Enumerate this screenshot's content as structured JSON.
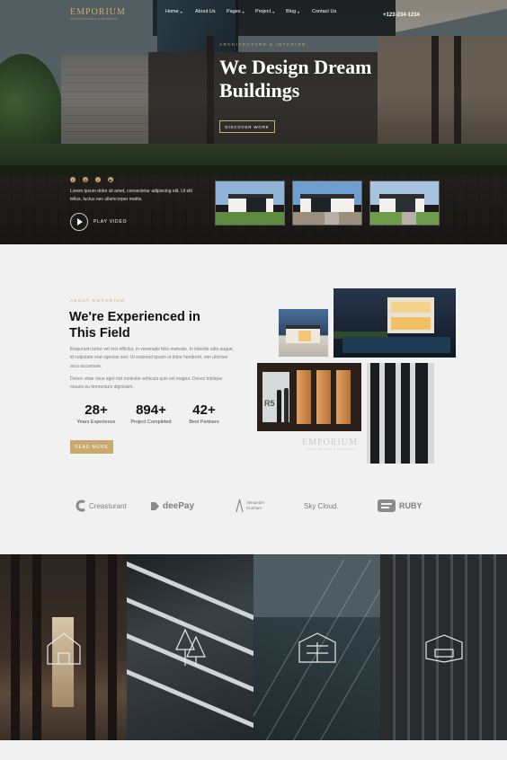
{
  "brand": {
    "name": "EMPORIUM",
    "tagline": "ARCHITECTURE & INTERIOR"
  },
  "nav": {
    "items": [
      {
        "label": "Home",
        "caret": "▾"
      },
      {
        "label": "About Us",
        "caret": ""
      },
      {
        "label": "Pages",
        "caret": "▾"
      },
      {
        "label": "Project",
        "caret": "▾"
      },
      {
        "label": "Blog",
        "caret": "▾"
      },
      {
        "label": "Contact Us",
        "caret": ""
      }
    ],
    "phone": "+123-234-1234"
  },
  "hero": {
    "subtitle": "ARCHITECTURE & INTERIOR",
    "title": "We Design Dream Buildings",
    "button": "DISCOVER WORK",
    "socials": [
      "facebook-icon",
      "instagram-icon",
      "twitter-icon",
      "youtube-icon"
    ],
    "description": "Lorem ipsum dolor sit amet, consectetur adipiscing elit. Ut elit tellus, luctus nec ullamcorper mattis.",
    "play_label": "PLAY VIDEO"
  },
  "about": {
    "eyebrow": "ABOUT EMPORIUM",
    "title": "We're Experienced in This Field",
    "paragraph1": "Emporium tortor vel orci efficitur, in venenatis felis molestie. In lobortis odio augue, id vulputate erat egestas sed. Ut euismod ipsum ut dolor hendrerit, non ultricies arcu accumsan.",
    "paragraph2": "Donec vitae risus eget nisl molestie vehicula quis vel magna. Donec tristique mauris eu fermentum dignissim.",
    "stats": [
      {
        "value": "28+",
        "label": "Years Experience"
      },
      {
        "value": "894+",
        "label": "Project Completed"
      },
      {
        "value": "42+",
        "label": "Best Partners"
      }
    ],
    "button": "READ MORE"
  },
  "brands": [
    {
      "name": "Creasturant",
      "small": ""
    },
    {
      "name": "deePay",
      "small": ""
    },
    {
      "name": "Alexander",
      "small": "Dunham"
    },
    {
      "name": "Sky Cloud.",
      "small": ""
    },
    {
      "name": "RUBY",
      "small": ""
    }
  ],
  "gallery": {
    "tiles": [
      {
        "icon": "house-outline-icon"
      },
      {
        "icon": "trees-outline-icon"
      },
      {
        "icon": "building-outline-icon"
      },
      {
        "icon": "interior-outline-icon"
      }
    ]
  },
  "colors": {
    "accent": "#c9a96e",
    "dark": "#111111",
    "bg": "#f1f1f1"
  }
}
